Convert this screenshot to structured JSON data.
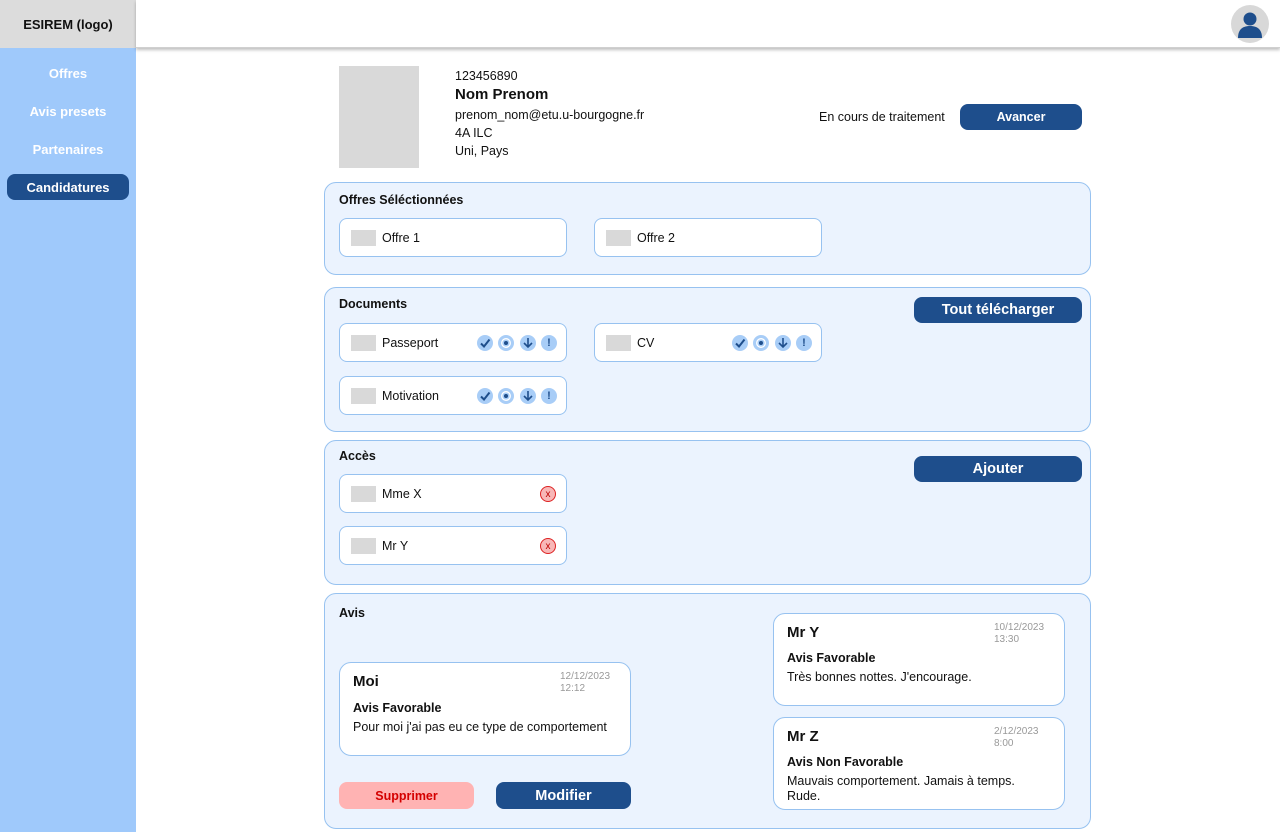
{
  "app": {
    "logo": "ESIREM (logo)"
  },
  "sidebar": {
    "items": [
      {
        "label": "Offres"
      },
      {
        "label": "Avis presets"
      },
      {
        "label": "Partenaires"
      },
      {
        "label": "Candidatures",
        "active": true
      }
    ]
  },
  "header": {
    "avatar_icon": "user-icon"
  },
  "profile": {
    "id": "123456890",
    "name": "Nom Prenom",
    "email": "prenom_nom@etu.u-bourgogne.fr",
    "program": "4A ILC",
    "location": "Uni, Pays",
    "status": "En cours de traitement",
    "advance_label": "Avancer"
  },
  "offers": {
    "title": "Offres Séléctionnées",
    "items": [
      {
        "label": "Offre 1"
      },
      {
        "label": "Offre 2"
      }
    ]
  },
  "documents": {
    "title": "Documents",
    "download_all_label": "Tout télécharger",
    "items": [
      {
        "label": "Passeport"
      },
      {
        "label": "CV"
      },
      {
        "label": "Motivation"
      }
    ],
    "icons": [
      "check-icon",
      "view-icon",
      "download-icon",
      "alert-icon"
    ]
  },
  "access": {
    "title": "Accès",
    "add_label": "Ajouter",
    "items": [
      {
        "label": "Mme X"
      },
      {
        "label": "Mr Y"
      }
    ],
    "remove_glyph": "x"
  },
  "reviews": {
    "title": "Avis",
    "mine": {
      "author": "Moi",
      "date": "12/12/2023",
      "time": "12:12",
      "verdict": "Avis Favorable",
      "text": "Pour moi j'ai pas eu ce type de comportement"
    },
    "others": [
      {
        "author": "Mr Y",
        "date": "10/12/2023",
        "time": "13:30",
        "verdict": "Avis Favorable",
        "text": "Très bonnes nottes. J'encourage."
      },
      {
        "author": "Mr Z",
        "date": "2/12/2023",
        "time": "8:00",
        "verdict": "Avis Non Favorable",
        "text": "Mauvais comportement. Jamais à temps. Rude."
      }
    ],
    "delete_label": "Supprimer",
    "edit_label": "Modifier"
  },
  "colors": {
    "primary": "#1e4e8c",
    "sidebar": "#9fc9fb",
    "card_bg": "#ebf3fe",
    "card_border": "#97c2f0",
    "danger": "#ffb3b3"
  }
}
